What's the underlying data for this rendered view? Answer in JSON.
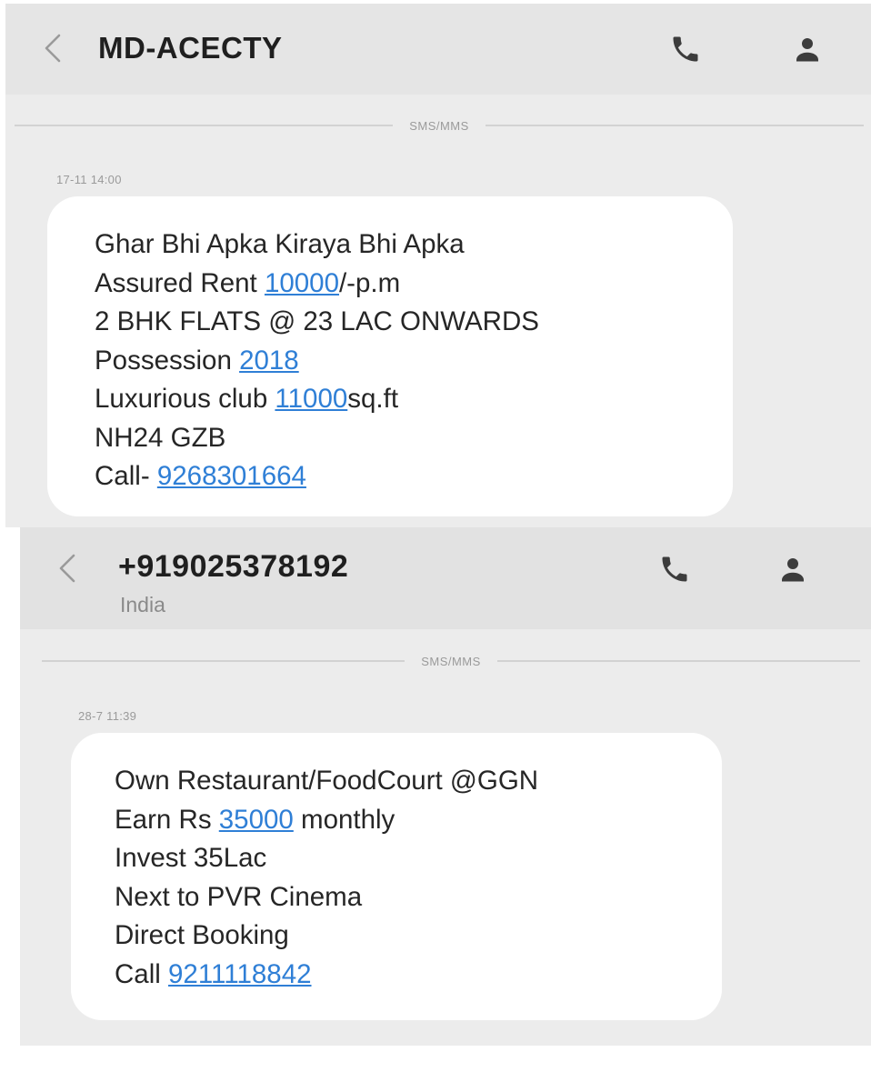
{
  "conversation1": {
    "header": {
      "title": "MD-ACECTY"
    },
    "separator": "SMS/MMS",
    "timestamp": "17-11 14:00",
    "message": {
      "line1": "Ghar Bhi Apka Kiraya Bhi Apka",
      "line2_prefix": "Assured Rent ",
      "line2_link": "10000",
      "line2_suffix": "/-p.m",
      "line3": "2 BHK FLATS @ 23 LAC ONWARDS",
      "line4_prefix": "Possession ",
      "line4_link": "2018",
      "line5_prefix": "Luxurious club ",
      "line5_link": "11000",
      "line5_suffix": "sq.ft",
      "line6": "NH24 GZB",
      "line7_prefix": "Call- ",
      "line7_link": "9268301664"
    }
  },
  "conversation2": {
    "header": {
      "title": "+919025378192",
      "subtitle": "India"
    },
    "separator": "SMS/MMS",
    "timestamp": "28-7 11:39",
    "message": {
      "line1": "Own Restaurant/FoodCourt @GGN",
      "line2_prefix": "Earn  Rs ",
      "line2_link": "35000",
      "line2_suffix": " monthly",
      "line3": "Invest 35Lac",
      "line4": "Next to PVR Cinema",
      "line5": "Direct Booking",
      "line6_prefix": "Call ",
      "line6_link": "9211118842"
    }
  },
  "icons": {
    "back": "chevron-left-icon",
    "call": "phone-icon",
    "contact": "person-icon"
  },
  "colors": {
    "link": "#2f7fd6",
    "background": "#ececec",
    "bubble": "#ffffff",
    "header": "#e5e5e5"
  }
}
